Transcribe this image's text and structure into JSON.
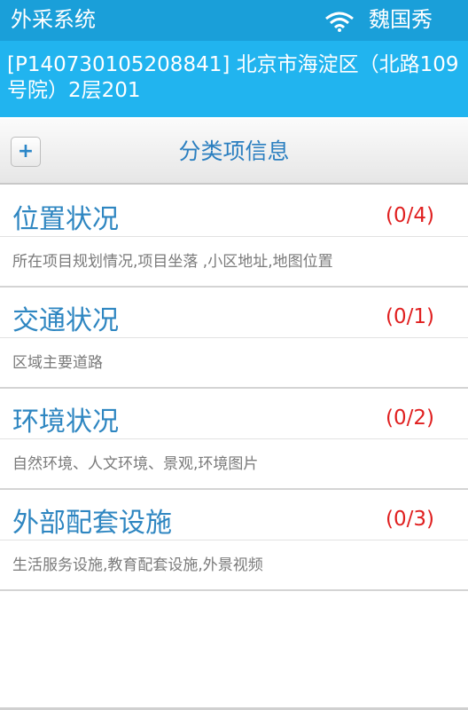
{
  "statusbar": {
    "app_title": "外采系统",
    "user_name": "魏国秀",
    "wifi_icon": "wifi-icon"
  },
  "address": {
    "text": "[P140730105208841] 北京市海淀区（北路109号院）2层201"
  },
  "section": {
    "title": "分类项信息",
    "add_label": "+"
  },
  "categories": [
    {
      "name": "位置状况",
      "count": "(0/4)",
      "desc": "所在项目规划情况,项目坐落 ,小区地址,地图位置"
    },
    {
      "name": "交通状况",
      "count": "(0/1)",
      "desc": "区域主要道路"
    },
    {
      "name": "环境状况",
      "count": "(0/2)",
      "desc": "自然环境、人文环境、景观,环境图片"
    },
    {
      "name": "外部配套设施",
      "count": "(0/3)",
      "desc": "生活服务设施,教育配套设施,外景视频"
    }
  ],
  "colors": {
    "statusbar": "#1a9fd9",
    "addressbar": "#21b4ef",
    "accent": "#2e86c1",
    "count": "#e02020"
  }
}
